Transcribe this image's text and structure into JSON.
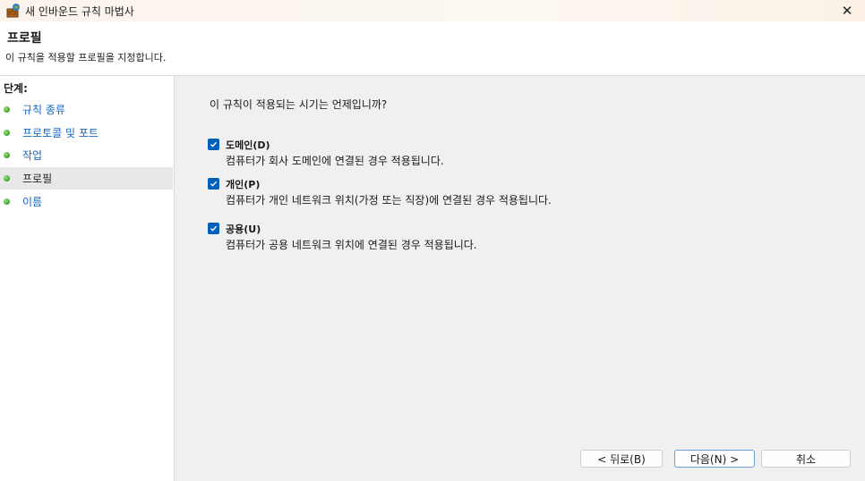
{
  "window": {
    "title": "새 인바운드 규칙 마법사",
    "close_glyph": "✕"
  },
  "header": {
    "title": "프로필",
    "subtitle": "이 규칙을 적용할 프로필을 지정합니다."
  },
  "steps": {
    "title": "단계:",
    "items": [
      {
        "label": "규칙 종류",
        "active": false
      },
      {
        "label": "프로토콜 및 포트",
        "active": false
      },
      {
        "label": "작업",
        "active": false
      },
      {
        "label": "프로필",
        "active": true
      },
      {
        "label": "이름",
        "active": false
      }
    ]
  },
  "main": {
    "question": "이 규칙이 적용되는 시기는 언제입니까?",
    "options": [
      {
        "label": "도메인(D)",
        "description": "컴퓨터가 회사 도메인에 연결된 경우 적용됩니다.",
        "checked": true
      },
      {
        "label": "개인(P)",
        "description": "컴퓨터가 개인 네트워크 위치(가정 또는 직장)에 연결된 경우 적용됩니다.",
        "checked": true
      },
      {
        "label": "공용(U)",
        "description": "컴퓨터가 공용 네트워크 위치에 연결된 경우 적용됩니다.",
        "checked": true
      }
    ]
  },
  "buttons": {
    "back": "< 뒤로(B)",
    "next": "다음(N) >",
    "cancel": "취소"
  },
  "colors": {
    "accent": "#005fb8",
    "link": "#1565c0",
    "bullet": "#3ea12a"
  }
}
